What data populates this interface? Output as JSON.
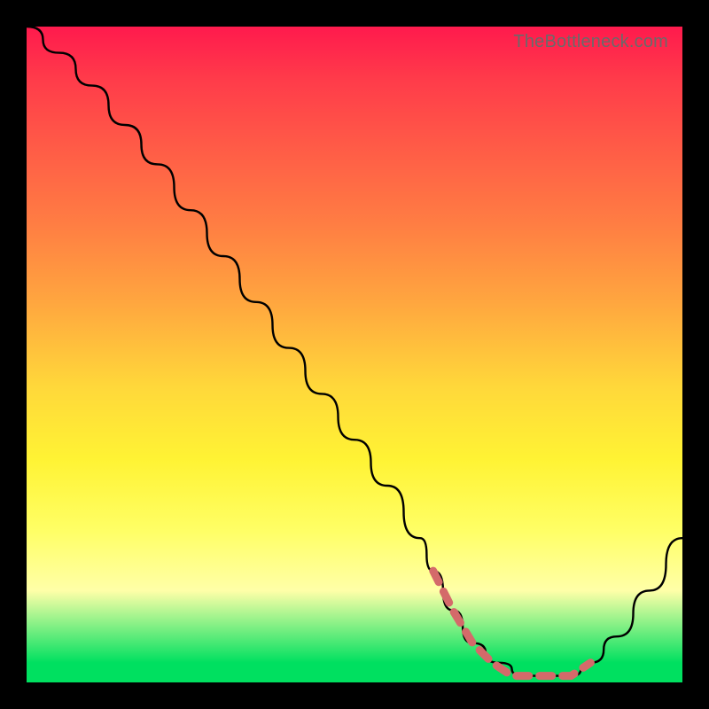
{
  "watermark": "TheBottleneck.com",
  "chart_data": {
    "type": "line",
    "title": "",
    "xlabel": "",
    "ylabel": "",
    "xlim": [
      0,
      100
    ],
    "ylim": [
      0,
      100
    ],
    "series": [
      {
        "name": "bottleneck-curve",
        "x": [
          0,
          5,
          10,
          15,
          20,
          25,
          30,
          35,
          40,
          45,
          50,
          55,
          60,
          62,
          65,
          68,
          72,
          76,
          80,
          83,
          86,
          90,
          95,
          100
        ],
        "values": [
          100,
          96,
          91,
          85,
          79,
          72,
          65,
          58,
          51,
          44,
          37,
          30,
          22,
          17,
          11,
          6,
          3,
          1,
          1,
          1,
          3,
          7,
          14,
          22
        ]
      },
      {
        "name": "optimal-range-dots",
        "x": [
          62,
          65,
          68,
          71,
          74,
          77,
          80,
          83,
          86
        ],
        "values": [
          17,
          11,
          6,
          3,
          1,
          1,
          1,
          1,
          3
        ]
      }
    ],
    "colors": {
      "curve": "#000000",
      "dots": "#d46a6a",
      "gradient_top": "#ff1a4d",
      "gradient_mid": "#ffff66",
      "gradient_bottom": "#00e060"
    }
  }
}
